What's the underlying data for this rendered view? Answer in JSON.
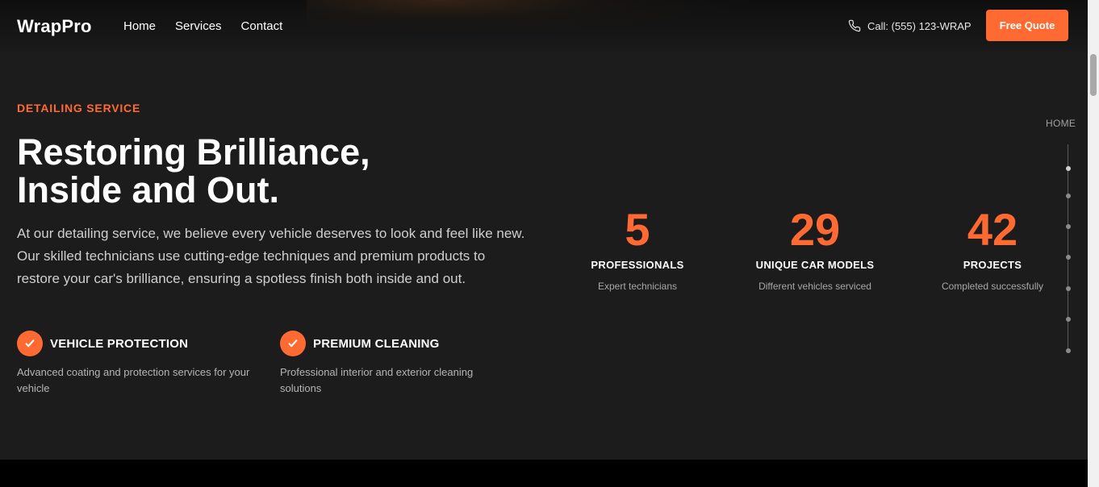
{
  "header": {
    "logo": "WrapPro",
    "nav": [
      "Home",
      "Services",
      "Contact"
    ],
    "call_label": "Call: (555) 123-WRAP",
    "cta_label": "Free Quote"
  },
  "hero": {
    "eyebrow": "DETAILING SERVICE",
    "title_line1": "Restoring Brilliance,",
    "title_line2": "Inside and Out.",
    "description": "At our detailing service, we believe every vehicle deserves to look and feel like new. Our skilled technicians use cutting-edge techniques and premium products to restore your car's brilliance, ensuring a spotless finish both inside and out."
  },
  "features": [
    {
      "title": "VEHICLE PROTECTION",
      "desc": "Advanced coating and protection services for your vehicle"
    },
    {
      "title": "PREMIUM CLEANING",
      "desc": "Professional interior and exterior cleaning solutions"
    }
  ],
  "stats": [
    {
      "value": "5",
      "label": "PROFESSIONALS",
      "sub": "Expert technicians"
    },
    {
      "value": "29",
      "label": "UNIQUE CAR MODELS",
      "sub": "Different vehicles serviced"
    },
    {
      "value": "42",
      "label": "PROJECTS",
      "sub": "Completed successfully"
    }
  ],
  "side_nav": {
    "label": "HOME",
    "dot_count": 7,
    "active_index": 0
  },
  "colors": {
    "accent": "#ff6a33",
    "background": "#1d1c1d",
    "text": "#ffffff",
    "muted": "#b5b5b5"
  },
  "icons": {
    "phone": "phone-icon",
    "check": "check-icon"
  }
}
